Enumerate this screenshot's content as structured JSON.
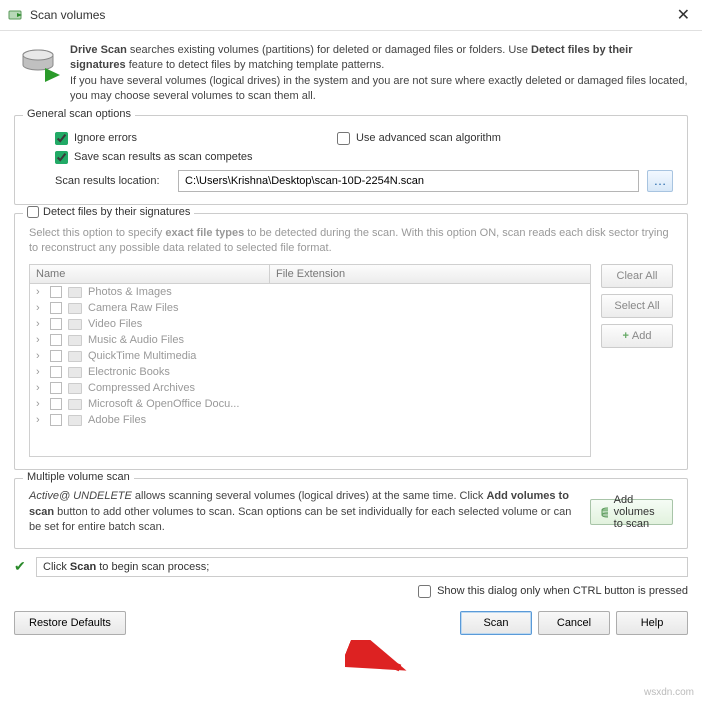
{
  "titlebar": {
    "title": "Scan volumes"
  },
  "intro": {
    "line1a": "Drive Scan",
    "line1b": " searches existing volumes (partitions) for deleted or damaged files or folders. Use ",
    "line1c": "Detect files by their signatures",
    "line1d": " feature to detect files by matching template patterns.",
    "line2": "If you have several volumes (logical drives) in the system and you are not sure where exactly deleted or damaged files located, you may choose several volumes to scan them all."
  },
  "general": {
    "legend": "General scan options",
    "ignore_errors": "Ignore errors",
    "use_advanced": "Use advanced scan algorithm",
    "save_results": "Save scan results as scan competes",
    "location_label": "Scan results location:",
    "location_value": "C:\\Users\\Krishna\\Desktop\\scan-10D-2254N.scan"
  },
  "signatures": {
    "legend": "Detect files by their signatures",
    "desc1": "Select this option to specify ",
    "desc1b": "exact file types",
    "desc1c": " to be detected during the scan. With this option ON, scan reads each disk sector trying to reconstruct any possible data related to selected file format.",
    "col_name": "Name",
    "col_ext": "File Extension",
    "items": [
      "Photos & Images",
      "Camera Raw Files",
      "Video Files",
      "Music & Audio Files",
      "QuickTime Multimedia",
      "Electronic Books",
      "Compressed Archives",
      "Microsoft & OpenOffice Docu...",
      "Adobe Files"
    ],
    "clear_all": "Clear All",
    "select_all": "Select All",
    "add": "Add"
  },
  "multi": {
    "legend": "Multiple volume scan",
    "desc1": "Active@ UNDELETE",
    "desc2": " allows scanning several volumes (logical drives) at the same time. Click ",
    "desc3": "Add volumes to scan",
    "desc4": " button to add other volumes to scan. Scan options can be set individually for each selected volume or can be set for entire batch scan.",
    "add_button": "Add volumes to scan"
  },
  "status": {
    "text_a": "Click ",
    "text_b": "Scan",
    "text_c": " to begin scan process;"
  },
  "show_dialog": "Show this dialog only when CTRL button is pressed",
  "buttons": {
    "restore": "Restore Defaults",
    "scan": "Scan",
    "cancel": "Cancel",
    "help": "Help"
  },
  "watermark": "wsxdn.com"
}
